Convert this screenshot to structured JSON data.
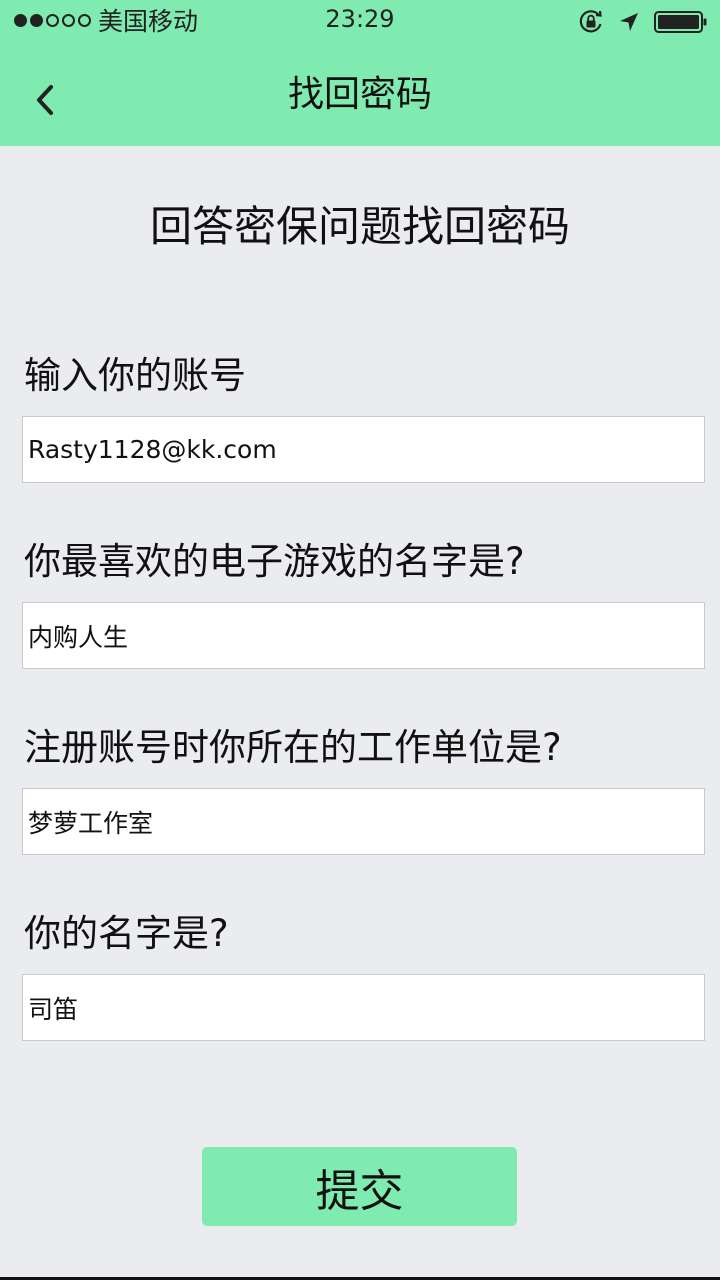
{
  "status_bar": {
    "signal_dots": [
      true,
      true,
      false,
      false,
      false
    ],
    "carrier": "美国移动",
    "time": "23:29",
    "icons": [
      "orientation-lock-icon",
      "location-arrow-icon",
      "battery-icon"
    ]
  },
  "nav": {
    "back_icon": "chevron-left-icon",
    "title": "找回密码"
  },
  "page": {
    "heading": "回答密保问题找回密码"
  },
  "form": {
    "account": {
      "label": "输入你的账号",
      "value": "Rasty1128@kk.com"
    },
    "q1": {
      "label": "你最喜欢的电子游戏的名字是?",
      "value": "内购人生"
    },
    "q2": {
      "label": "注册账号时你所在的工作单位是?",
      "value": "梦萝工作室"
    },
    "q3": {
      "label": "你的名字是?",
      "value": "司笛"
    },
    "submit_label": "提交"
  },
  "colors": {
    "accent": "#80ebb0",
    "background": "#ebecf0",
    "field_border": "#c9c9c9"
  }
}
